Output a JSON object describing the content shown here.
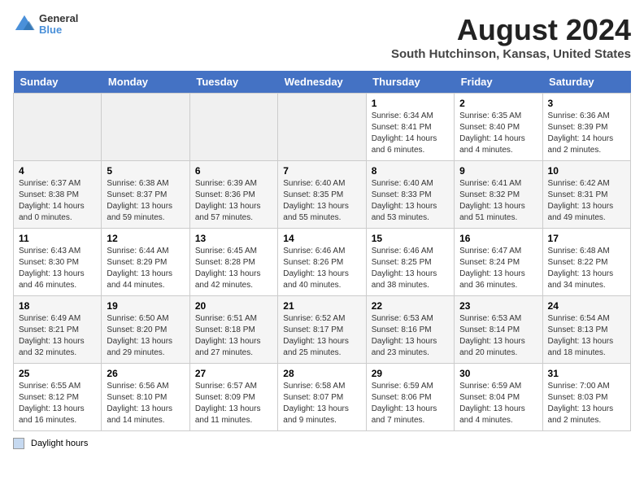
{
  "header": {
    "logo_line1": "General",
    "logo_line2": "Blue",
    "month_title": "August 2024",
    "location": "South Hutchinson, Kansas, United States"
  },
  "days_of_week": [
    "Sunday",
    "Monday",
    "Tuesday",
    "Wednesday",
    "Thursday",
    "Friday",
    "Saturday"
  ],
  "weeks": [
    [
      {
        "day": "",
        "info": ""
      },
      {
        "day": "",
        "info": ""
      },
      {
        "day": "",
        "info": ""
      },
      {
        "day": "",
        "info": ""
      },
      {
        "day": "1",
        "info": "Sunrise: 6:34 AM\nSunset: 8:41 PM\nDaylight: 14 hours and 6 minutes."
      },
      {
        "day": "2",
        "info": "Sunrise: 6:35 AM\nSunset: 8:40 PM\nDaylight: 14 hours and 4 minutes."
      },
      {
        "day": "3",
        "info": "Sunrise: 6:36 AM\nSunset: 8:39 PM\nDaylight: 14 hours and 2 minutes."
      }
    ],
    [
      {
        "day": "4",
        "info": "Sunrise: 6:37 AM\nSunset: 8:38 PM\nDaylight: 14 hours and 0 minutes."
      },
      {
        "day": "5",
        "info": "Sunrise: 6:38 AM\nSunset: 8:37 PM\nDaylight: 13 hours and 59 minutes."
      },
      {
        "day": "6",
        "info": "Sunrise: 6:39 AM\nSunset: 8:36 PM\nDaylight: 13 hours and 57 minutes."
      },
      {
        "day": "7",
        "info": "Sunrise: 6:40 AM\nSunset: 8:35 PM\nDaylight: 13 hours and 55 minutes."
      },
      {
        "day": "8",
        "info": "Sunrise: 6:40 AM\nSunset: 8:33 PM\nDaylight: 13 hours and 53 minutes."
      },
      {
        "day": "9",
        "info": "Sunrise: 6:41 AM\nSunset: 8:32 PM\nDaylight: 13 hours and 51 minutes."
      },
      {
        "day": "10",
        "info": "Sunrise: 6:42 AM\nSunset: 8:31 PM\nDaylight: 13 hours and 49 minutes."
      }
    ],
    [
      {
        "day": "11",
        "info": "Sunrise: 6:43 AM\nSunset: 8:30 PM\nDaylight: 13 hours and 46 minutes."
      },
      {
        "day": "12",
        "info": "Sunrise: 6:44 AM\nSunset: 8:29 PM\nDaylight: 13 hours and 44 minutes."
      },
      {
        "day": "13",
        "info": "Sunrise: 6:45 AM\nSunset: 8:28 PM\nDaylight: 13 hours and 42 minutes."
      },
      {
        "day": "14",
        "info": "Sunrise: 6:46 AM\nSunset: 8:26 PM\nDaylight: 13 hours and 40 minutes."
      },
      {
        "day": "15",
        "info": "Sunrise: 6:46 AM\nSunset: 8:25 PM\nDaylight: 13 hours and 38 minutes."
      },
      {
        "day": "16",
        "info": "Sunrise: 6:47 AM\nSunset: 8:24 PM\nDaylight: 13 hours and 36 minutes."
      },
      {
        "day": "17",
        "info": "Sunrise: 6:48 AM\nSunset: 8:22 PM\nDaylight: 13 hours and 34 minutes."
      }
    ],
    [
      {
        "day": "18",
        "info": "Sunrise: 6:49 AM\nSunset: 8:21 PM\nDaylight: 13 hours and 32 minutes."
      },
      {
        "day": "19",
        "info": "Sunrise: 6:50 AM\nSunset: 8:20 PM\nDaylight: 13 hours and 29 minutes."
      },
      {
        "day": "20",
        "info": "Sunrise: 6:51 AM\nSunset: 8:18 PM\nDaylight: 13 hours and 27 minutes."
      },
      {
        "day": "21",
        "info": "Sunrise: 6:52 AM\nSunset: 8:17 PM\nDaylight: 13 hours and 25 minutes."
      },
      {
        "day": "22",
        "info": "Sunrise: 6:53 AM\nSunset: 8:16 PM\nDaylight: 13 hours and 23 minutes."
      },
      {
        "day": "23",
        "info": "Sunrise: 6:53 AM\nSunset: 8:14 PM\nDaylight: 13 hours and 20 minutes."
      },
      {
        "day": "24",
        "info": "Sunrise: 6:54 AM\nSunset: 8:13 PM\nDaylight: 13 hours and 18 minutes."
      }
    ],
    [
      {
        "day": "25",
        "info": "Sunrise: 6:55 AM\nSunset: 8:12 PM\nDaylight: 13 hours and 16 minutes."
      },
      {
        "day": "26",
        "info": "Sunrise: 6:56 AM\nSunset: 8:10 PM\nDaylight: 13 hours and 14 minutes."
      },
      {
        "day": "27",
        "info": "Sunrise: 6:57 AM\nSunset: 8:09 PM\nDaylight: 13 hours and 11 minutes."
      },
      {
        "day": "28",
        "info": "Sunrise: 6:58 AM\nSunset: 8:07 PM\nDaylight: 13 hours and 9 minutes."
      },
      {
        "day": "29",
        "info": "Sunrise: 6:59 AM\nSunset: 8:06 PM\nDaylight: 13 hours and 7 minutes."
      },
      {
        "day": "30",
        "info": "Sunrise: 6:59 AM\nSunset: 8:04 PM\nDaylight: 13 hours and 4 minutes."
      },
      {
        "day": "31",
        "info": "Sunrise: 7:00 AM\nSunset: 8:03 PM\nDaylight: 13 hours and 2 minutes."
      }
    ]
  ],
  "legend": {
    "label": "Daylight hours"
  }
}
